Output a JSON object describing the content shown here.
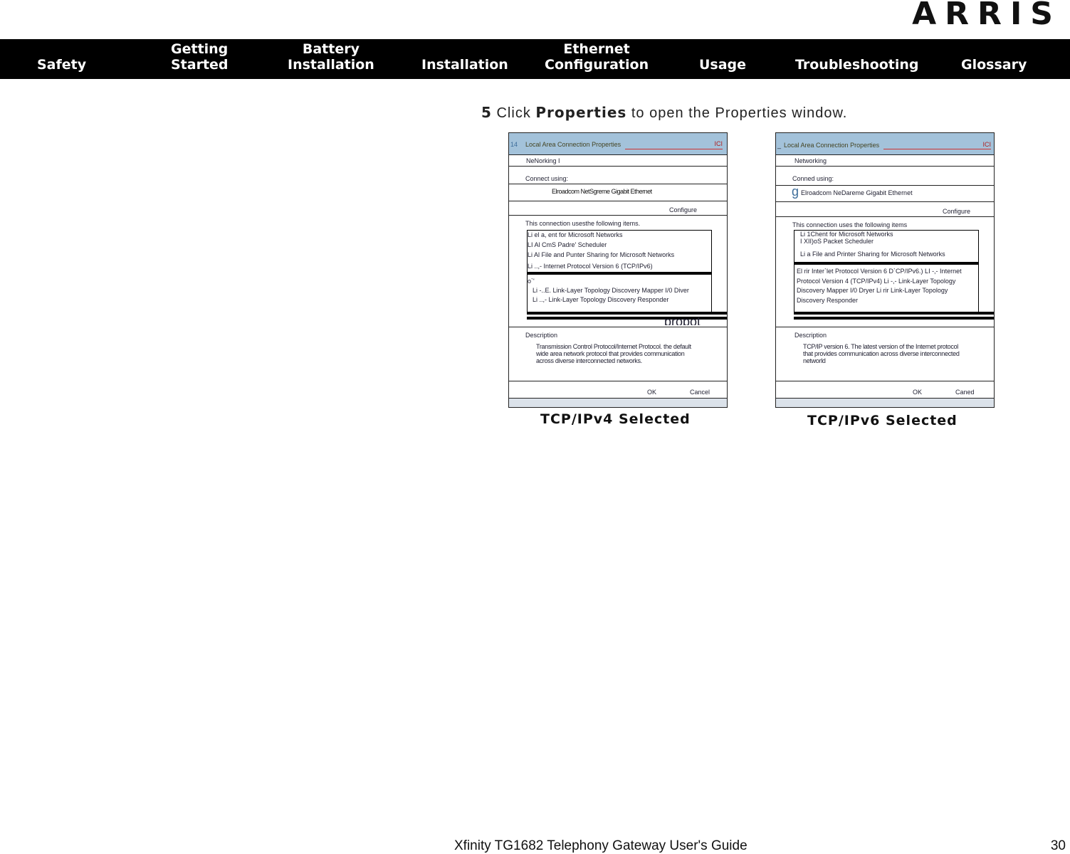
{
  "logo": "ARRIS",
  "nav": [
    "Safety",
    "Getting\nStarted",
    "Battery\nInstallation",
    "Installation",
    "Ethernet\nConfiguration",
    "Usage",
    "Troubleshooting",
    "Glossary"
  ],
  "step": {
    "num": "5",
    "pre": "Click",
    "bold": "Properties",
    "post": "to open the Properties window."
  },
  "left": {
    "icon": "14",
    "title": "Local Area Connection Properties",
    "close": "ICI",
    "tab": "NeNorking I",
    "connect": "Connect using:",
    "adapter": "Elroadcom NetSgreme Gigabit Ethernet",
    "configure": "Configure",
    "uses": "This connection usesthe following items.",
    "items": [
      "Li el a, ent for Microsoft Networks",
      "LI Al CmS Padre' Scheduler",
      "Li Al File and Punter Sharing for Microsoft Networks",
      "Li ..,- Internet Protocol Version 6 (TCP/IPv6)"
    ],
    "items2": [
      "o`'",
      "Li -..E. Link-Layer Topology Discovery Mapper I/0 Diver",
      "Li ..,- Link-Layer Topology Discovery Responder"
    ],
    "cut": "propot",
    "desc_label": "Description",
    "desc": "Transmission Control Protocol/Internet Protocol. the default wide area network protocol that provides communication across diverse interconnected networks.",
    "ok": "OK",
    "cancel": "Cancel"
  },
  "right": {
    "icon": "_",
    "title": "Local Area Connection Properties",
    "close": "ICI",
    "tab": "Networking",
    "connect": "Conned using:",
    "adapter_icon": "g",
    "adapter": "Elroadcom NeDareme Gigabit Ethernet",
    "configure": "Configure",
    "uses": "This connection uses the following items",
    "items": [
      "Li 1Chent for Microsoft Networks",
      "I XII)oS Packet Scheduler",
      "Li  a  File and Printer Sharing for Microsoft Networks"
    ],
    "items2": "El rir Inter`let Protocol Version 6 D`CP/IPv6.) LI -,- Internet Protocol Version 4 (TCP/IPv4) Li -,- Link-Layer Topology Discovery Mapper I/0 Dryer Li rir Link-Layer Topology Discovery Responder",
    "desc_label": "Description",
    "desc": "TCP/IP version 6. The latest version of the Internet protocol that provides communication across diverse interconnected networld",
    "ok": "OK",
    "cancel": "Caned"
  },
  "captions": [
    "TCP/IPv4 Selected",
    "TCP/IPv6 Selected"
  ],
  "footer": {
    "title": "Xfinity TG1682 Telephony Gateway User's Guide",
    "page": "30"
  }
}
